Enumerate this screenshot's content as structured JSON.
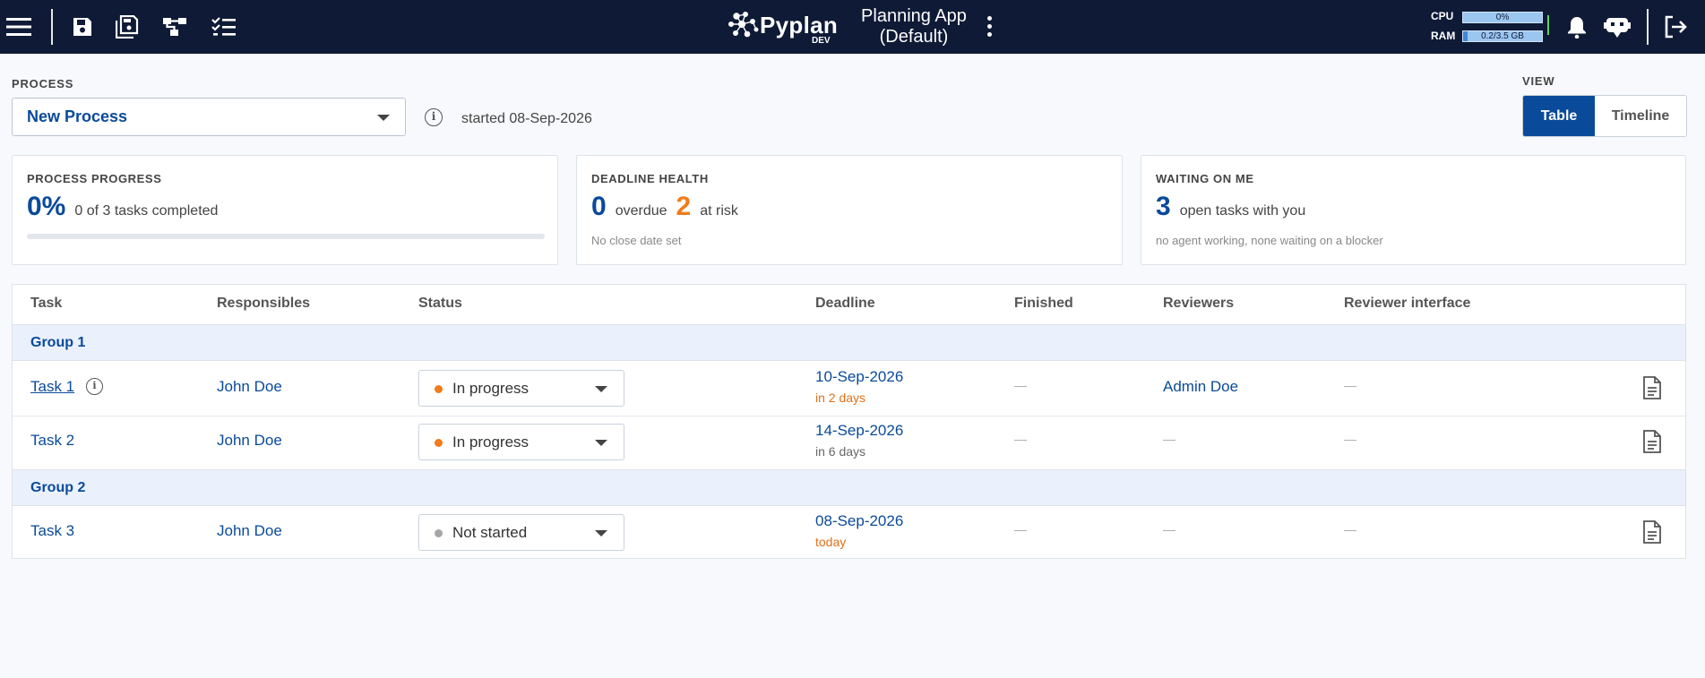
{
  "topbar": {
    "icons": [
      "menu-icon",
      "save-icon",
      "save-as-icon",
      "flow-icon",
      "checklist-icon",
      "bell-icon",
      "assistant-bot-icon",
      "logout-icon"
    ],
    "logo_text": "Pyplan",
    "logo_badge": "DEV",
    "app_title_line1": "Planning App",
    "app_title_line2": "(Default)",
    "cpu_label": "CPU",
    "cpu_value": "0%",
    "cpu_fraction": 0.0,
    "ram_label": "RAM",
    "ram_value": "0.2/3.5 GB",
    "ram_fraction": 0.057
  },
  "process": {
    "label": "PROCESS",
    "selected": "New Process",
    "started": "started 08-Sep-2026"
  },
  "view": {
    "label": "VIEW",
    "options": [
      "Table",
      "Timeline"
    ],
    "active": "Table"
  },
  "cards": {
    "progress": {
      "title": "PROCESS PROGRESS",
      "value": "0%",
      "text": "0 of 3 tasks completed",
      "fraction": 0.0
    },
    "deadline": {
      "title": "DEADLINE HEALTH",
      "overdue_value": "0",
      "overdue_text": "overdue",
      "risk_value": "2",
      "risk_text": "at risk",
      "sub": "No close date set"
    },
    "waiting": {
      "title": "WAITING ON ME",
      "value": "3",
      "text": "open tasks with you",
      "sub": "no agent working, none waiting on a blocker"
    }
  },
  "table": {
    "headers": {
      "task": "Task",
      "responsibles": "Responsibles",
      "status": "Status",
      "deadline": "Deadline",
      "finished": "Finished",
      "reviewers": "Reviewers",
      "reviewer_interface": "Reviewer interface"
    },
    "groups": [
      {
        "name": "Group 1"
      },
      {
        "name": "Group 2"
      }
    ],
    "rows": [
      {
        "task": "Task 1",
        "responsible": "John Doe",
        "status": "In progress",
        "status_color": "#f07c1a",
        "deadline": "10-Sep-2026",
        "deadline_note": "in 2 days",
        "note_color": "#e0701a",
        "finished": "—",
        "reviewers": "Admin Doe",
        "reviewer_interface": "—"
      },
      {
        "task": "Task 2",
        "responsible": "John Doe",
        "status": "In progress",
        "status_color": "#f07c1a",
        "deadline": "14-Sep-2026",
        "deadline_note": "in 6 days",
        "note_color": "#666666",
        "finished": "—",
        "reviewers": "—",
        "reviewer_interface": "—"
      },
      {
        "task": "Task 3",
        "responsible": "John Doe",
        "status": "Not started",
        "status_color": "#a6a6a6",
        "deadline": "08-Sep-2026",
        "deadline_note": "today",
        "note_color": "#e0701a",
        "finished": "—",
        "reviewers": "—",
        "reviewer_interface": "—"
      }
    ]
  },
  "colors": {
    "brand": "#0a4a9a",
    "topbar": "#0f1a36",
    "warning": "#f07c1a"
  }
}
